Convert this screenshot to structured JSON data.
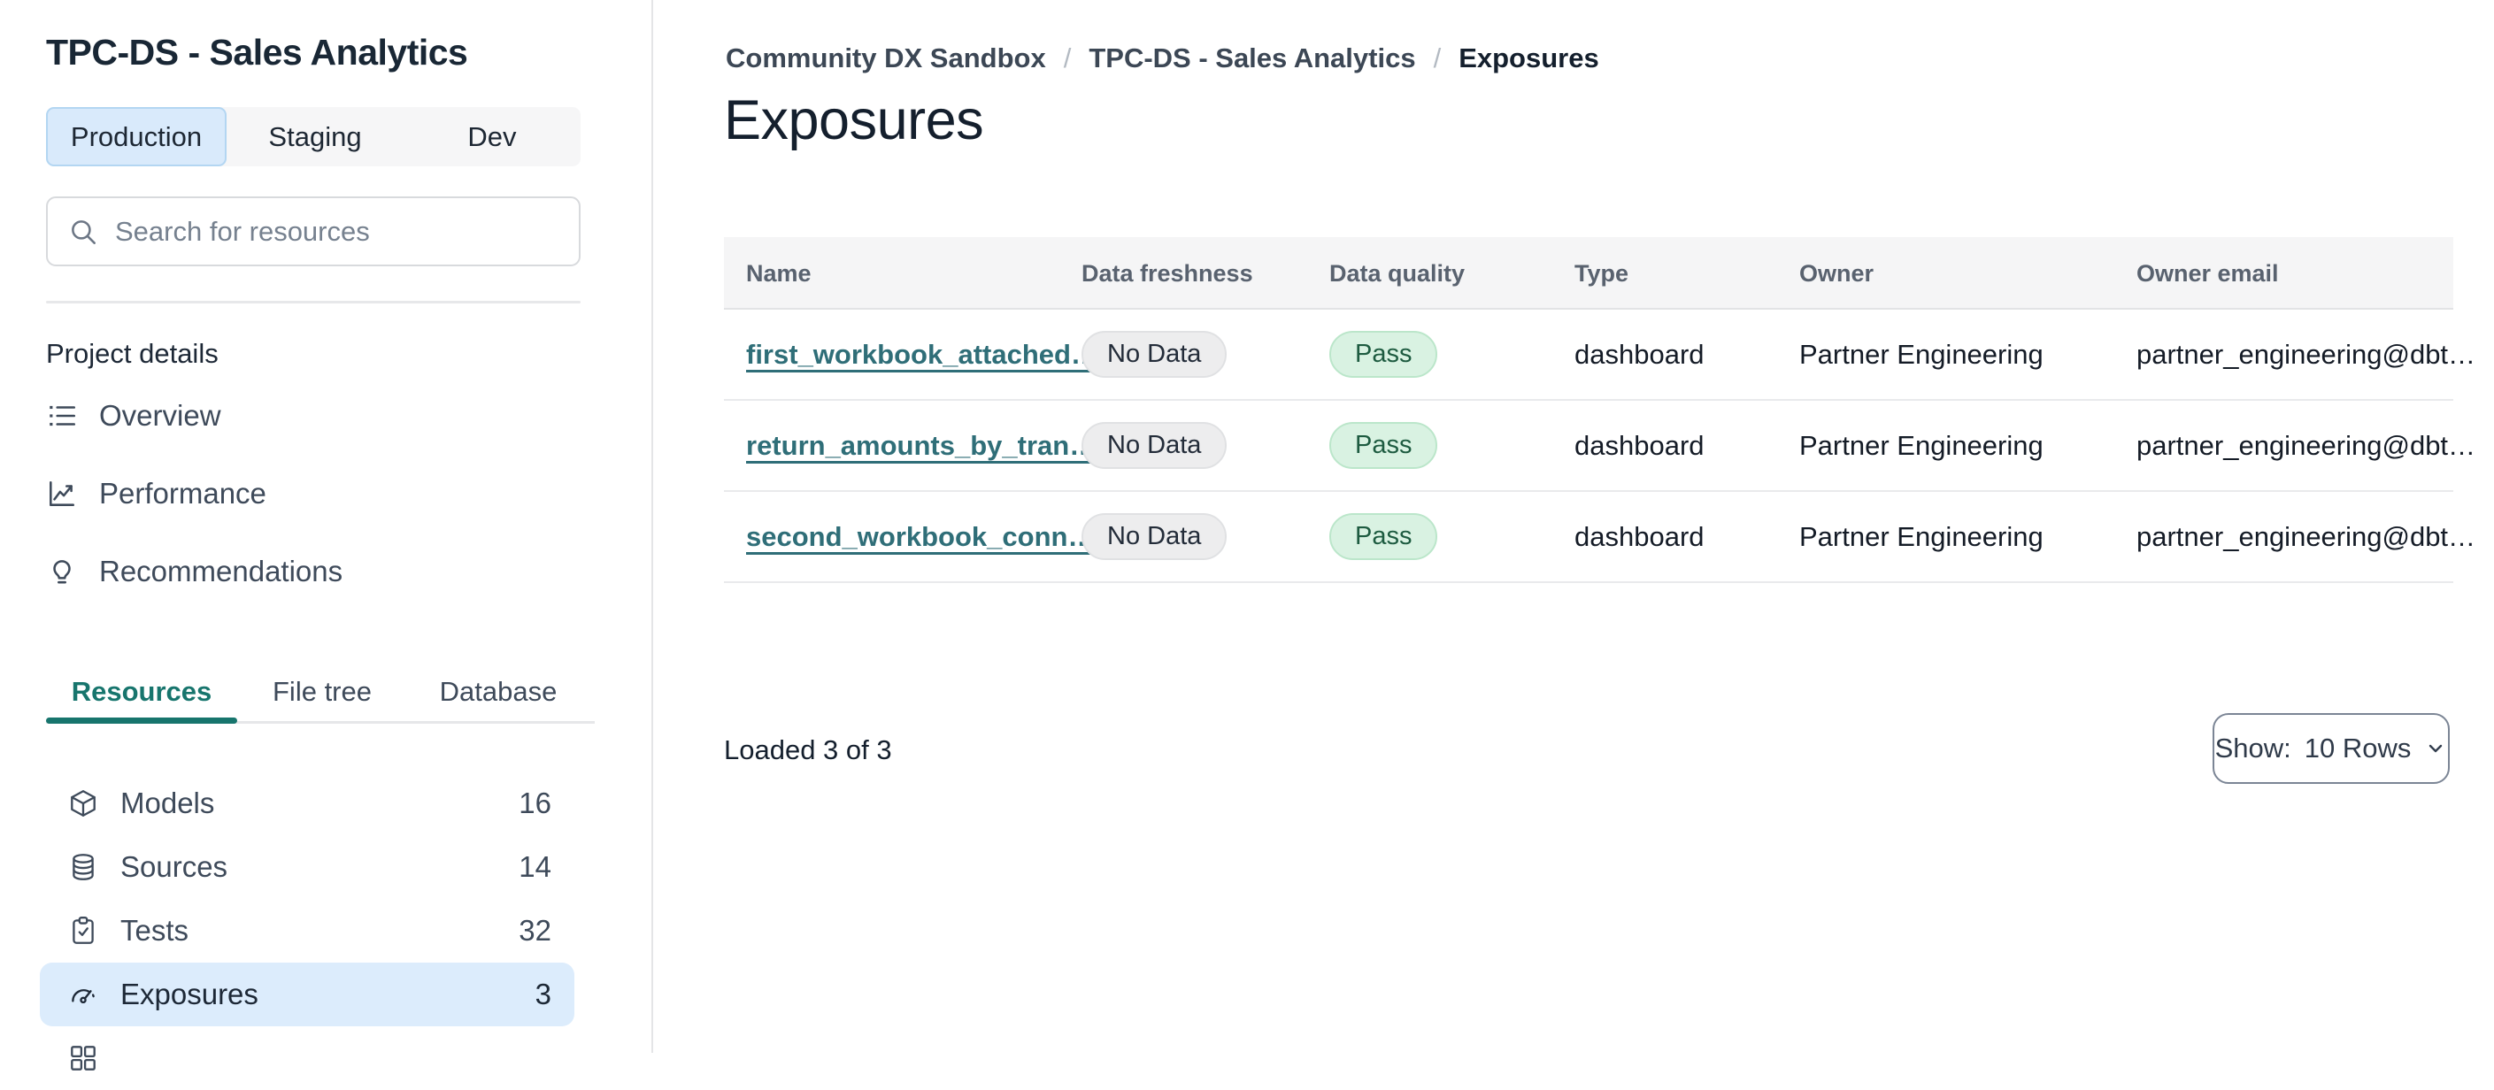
{
  "colors": {
    "accent_teal": "#17756d",
    "link_teal": "#2f6e78",
    "active_blue_bg": "#d9eafb",
    "active_blue_border": "#b3d6f2",
    "selected_row_bg": "#dcecfc",
    "badge_gray_bg": "#ededee",
    "badge_green_bg": "#d9f2e2",
    "badge_green_text": "#1d5b40",
    "header_bg": "#f5f5f6"
  },
  "sidebar": {
    "project_title": "TPC-DS - Sales Analytics",
    "env_tabs": [
      {
        "label": "Production",
        "active": true
      },
      {
        "label": "Staging",
        "active": false
      },
      {
        "label": "Dev",
        "active": false
      }
    ],
    "search": {
      "placeholder": "Search for resources",
      "icon": "search-icon"
    },
    "section_heading": "Project details",
    "nav": [
      {
        "icon": "list-icon",
        "label": "Overview"
      },
      {
        "icon": "chart-line-icon",
        "label": "Performance"
      },
      {
        "icon": "lightbulb-icon",
        "label": "Recommendations"
      }
    ],
    "view_tabs": [
      {
        "label": "Resources",
        "active": true
      },
      {
        "label": "File tree",
        "active": false
      },
      {
        "label": "Database",
        "active": false
      }
    ],
    "resources": [
      {
        "icon": "cube-icon",
        "label": "Models",
        "count": "16",
        "active": false
      },
      {
        "icon": "database-icon",
        "label": "Sources",
        "count": "14",
        "active": false
      },
      {
        "icon": "clipboard-check-icon",
        "label": "Tests",
        "count": "32",
        "active": false
      },
      {
        "icon": "gauge-icon",
        "label": "Exposures",
        "count": "3",
        "active": true
      }
    ]
  },
  "main": {
    "breadcrumb": [
      {
        "label": "Community DX Sandbox"
      },
      {
        "label": "TPC-DS - Sales Analytics"
      },
      {
        "label": "Exposures"
      }
    ],
    "breadcrumb_separator": "/",
    "page_title": "Exposures",
    "table": {
      "columns": [
        "Name",
        "Data freshness",
        "Data quality",
        "Type",
        "Owner",
        "Owner email"
      ],
      "rows": [
        {
          "name": "first_workbook_attached…",
          "freshness": "No Data",
          "quality": "Pass",
          "type": "dashboard",
          "owner": "Partner Engineering",
          "owner_email": "partner_engineering@dbt…"
        },
        {
          "name": "return_amounts_by_tran…",
          "freshness": "No Data",
          "quality": "Pass",
          "type": "dashboard",
          "owner": "Partner Engineering",
          "owner_email": "partner_engineering@dbt…"
        },
        {
          "name": "second_workbook_conn…",
          "freshness": "No Data",
          "quality": "Pass",
          "type": "dashboard",
          "owner": "Partner Engineering",
          "owner_email": "partner_engineering@dbt…"
        }
      ]
    },
    "footer": {
      "loaded_text": "Loaded 3 of 3",
      "show_label": "Show:",
      "show_value": "10 Rows",
      "chevron_icon": "chevron-down-icon"
    }
  }
}
